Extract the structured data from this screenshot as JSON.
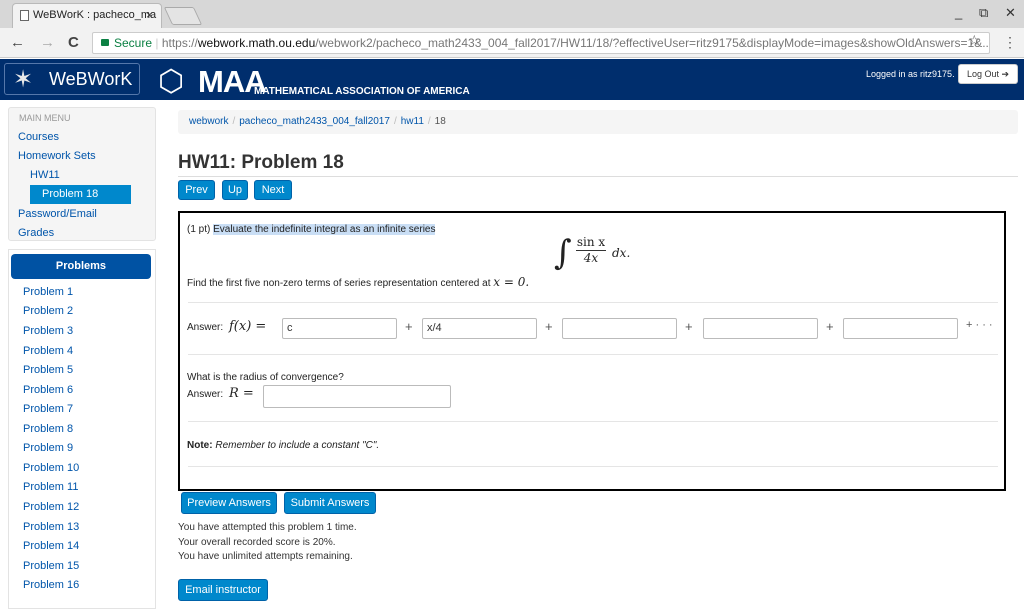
{
  "browser": {
    "tab_title": "WeBWorK : pacheco_ma",
    "tab_close": "×",
    "secure_label": "Secure",
    "url_scheme": "https://",
    "url_host": "webwork.math.ou.edu",
    "url_path": "/webwork2/pacheco_math2433_004_fall2017/HW11/18/?effectiveUser=ritz9175&displayMode=images&showOldAnswers=1&...",
    "back_icon": "←",
    "forward_icon": "→",
    "reload_icon": "C",
    "star_icon": "☆",
    "menu_icon": "⋮",
    "minimize_icon": "_",
    "restore_icon": "⧉",
    "close_icon": "✕"
  },
  "header": {
    "logo_text": "WeBWorK",
    "maa_big": "MAA",
    "maa_small": "MATHEMATICAL ASSOCIATION OF AMERICA",
    "logged_in": "Logged in as ritz9175.",
    "logout_label": "Log Out ➔"
  },
  "sidebar": {
    "heading": "MAIN MENU",
    "courses": "Courses",
    "homework_sets": "Homework Sets",
    "hw11": "HW11",
    "problem18": "Problem 18",
    "password_email": "Password/Email",
    "grades": "Grades",
    "problems_heading": "Problems",
    "problems": [
      "Problem 1",
      "Problem 2",
      "Problem 3",
      "Problem 4",
      "Problem 5",
      "Problem 6",
      "Problem 7",
      "Problem 8",
      "Problem 9",
      "Problem 10",
      "Problem 11",
      "Problem 12",
      "Problem 13",
      "Problem 14",
      "Problem 15",
      "Problem 16"
    ]
  },
  "main": {
    "breadcrumb": [
      "webwork",
      "pacheco_math2433_004_fall2017",
      "hw11",
      "18"
    ],
    "breadcrumb_sep": "/",
    "title": "HW11: Problem 18",
    "prev": "Prev",
    "up": "Up",
    "next": "Next",
    "points": "(1 pt)",
    "prompt": "Evaluate the indefinite integral as an infinite series",
    "integral_num": "sin x",
    "integral_den": "4x",
    "integral_dx": "dx.",
    "find_text": "Find the first five non-zero terms of series representation centered at",
    "center_expr": "x = 0.",
    "answer_label": "Answer:",
    "fx_label": "f(x) =",
    "answers": [
      "c",
      "x/4",
      "",
      "",
      ""
    ],
    "plus": "+",
    "plus_dots": "+ · · ·",
    "radius_question": "What is the radius of convergence?",
    "r_label": "R =",
    "r_value": "",
    "note_bold": "Note:",
    "note_text": "Remember to include a constant \"C\".",
    "preview_btn": "Preview Answers",
    "submit_btn": "Submit Answers",
    "status1": "You have attempted this problem 1 time.",
    "status2": "Your overall recorded score is 20%.",
    "status3": "You have unlimited attempts remaining.",
    "email_btn": "Email instructor"
  }
}
